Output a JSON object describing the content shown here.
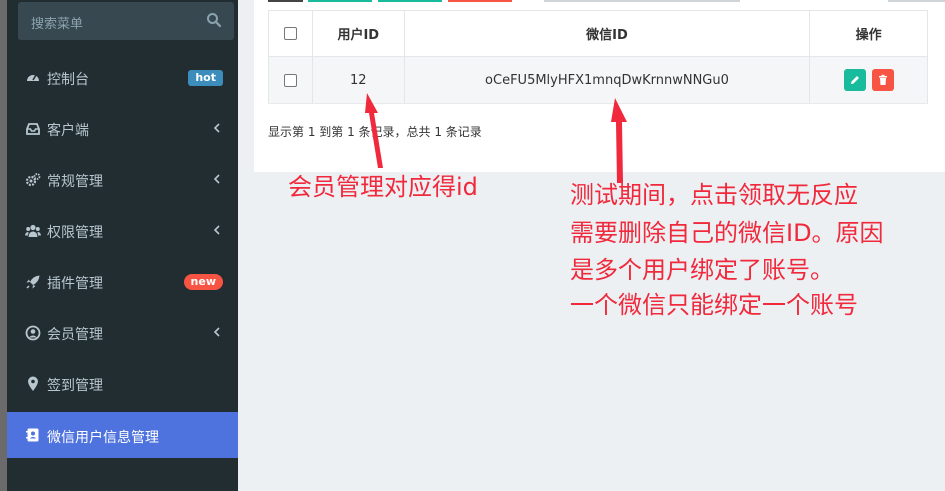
{
  "sidebar": {
    "search_placeholder": "搜索菜单",
    "items": [
      {
        "label": "控制台",
        "icon": "dashboard-icon",
        "badge": "hot"
      },
      {
        "label": "客户端",
        "icon": "inbox-icon"
      },
      {
        "label": "常规管理",
        "icon": "cogs-icon"
      },
      {
        "label": "权限管理",
        "icon": "group-icon"
      },
      {
        "label": "插件管理",
        "icon": "rocket-icon",
        "badge": "new"
      },
      {
        "label": "会员管理",
        "icon": "user-circle-icon"
      },
      {
        "label": "签到管理",
        "icon": "map-marker-icon"
      },
      {
        "label": "微信用户信息管理",
        "icon": "address-book-icon"
      }
    ]
  },
  "table": {
    "headers": {
      "user_id": "用户ID",
      "wechat_id": "微信ID",
      "actions": "操作"
    },
    "rows": [
      {
        "user_id": "12",
        "wechat_id": "oCeFU5MlyHFX1mnqDwKrnnwNNGu0"
      }
    ]
  },
  "pager": {
    "info": "显示第 1 到第 1 条记录，总共 1 条记录"
  },
  "annotations": {
    "left": "会员管理对应得id",
    "right_lines": [
      "测试期间，点击领取无反应",
      "需要删除自己的微信ID。原因",
      "是多个用户绑定了账号。",
      "一个微信只能绑定一个账号"
    ]
  },
  "colors": {
    "sidebar_bg": "#222d32",
    "active_bg": "#4e72de",
    "annotation": "#f0293c",
    "edit_btn": "#18bc9c",
    "delete_btn": "#f75444"
  }
}
